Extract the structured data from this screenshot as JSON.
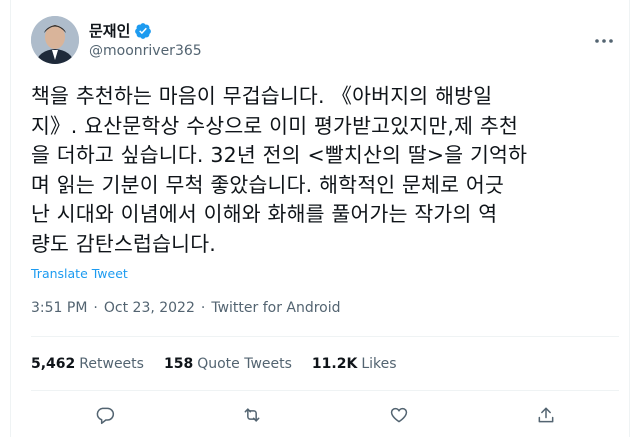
{
  "user": {
    "display_name": "문재인",
    "handle": "@moonriver365"
  },
  "tweet": {
    "lines": [
      "책을 추천하는 마음이 무겁습니다. 《아버지의 해방일",
      "지》. 요산문학상 수상으로 이미 평가받고있지만,제 추천",
      "을 더하고 싶습니다. 32년 전의 <빨치산의 딸>을 기억하",
      "며 읽는 기분이 무척 좋았습니다. 해학적인 문체로 어긋",
      "난 시대와 이념에서 이해와 화해를 풀어가는 작가의 역",
      "량도 감탄스럽습니다."
    ],
    "translate_label": "Translate Tweet",
    "time": "3:51 PM",
    "separator": "·",
    "date": "Oct 23, 2022",
    "source": "Twitter for Android"
  },
  "stats": {
    "retweets_count": "5,462",
    "retweets_label": "Retweets",
    "quotes_count": "158",
    "quotes_label": "Quote Tweets",
    "likes_count": "11.2K",
    "likes_label": "Likes"
  },
  "icons": {
    "verified": "verified-badge-icon",
    "more": "more-options-icon",
    "reply": "reply-icon",
    "retweet": "retweet-icon",
    "like": "like-icon",
    "share": "share-icon"
  },
  "colors": {
    "accent": "#1d9bf0",
    "text": "#0f1419",
    "secondary": "#536471",
    "divider": "#eff3f4"
  }
}
